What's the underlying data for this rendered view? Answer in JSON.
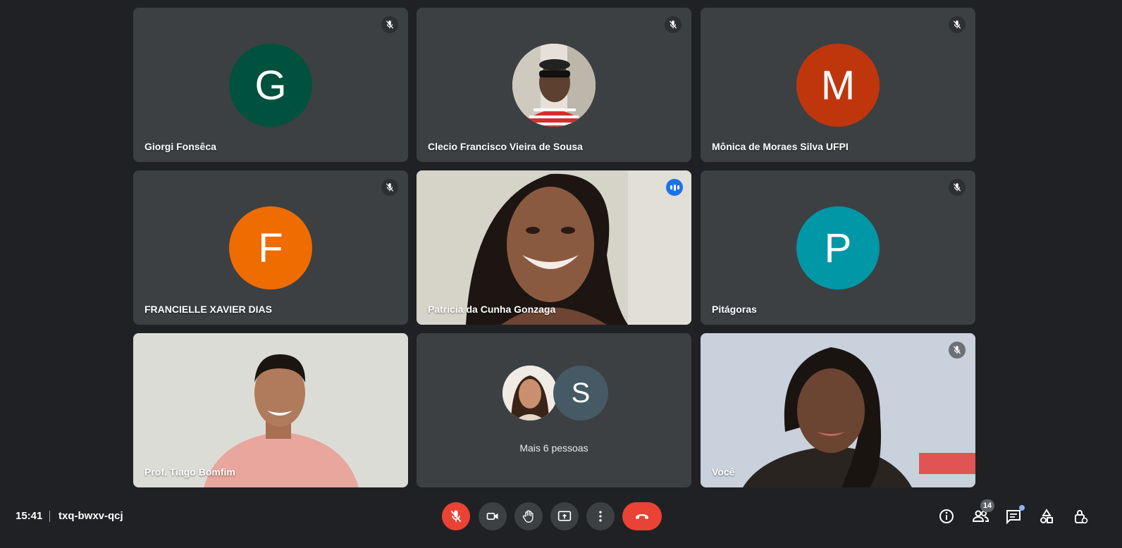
{
  "colors": {
    "background": "#202124",
    "tile": "#3c4043",
    "active_outline": "#8ab4f8",
    "danger": "#ea4335"
  },
  "participants": [
    {
      "name": "Giorgi Fonsêca",
      "initial": "G",
      "avatar_color": "#01513f",
      "muted": true
    },
    {
      "name": "Clecio Francisco Vieira de Sousa",
      "avatar": "photo",
      "muted": true
    },
    {
      "name": "Mônica de Moraes Silva UFPI",
      "initial": "M",
      "avatar_color": "#bf360c",
      "muted": true
    },
    {
      "name": "FRANCIELLE XAVIER DIAS",
      "initial": "F",
      "avatar_color": "#ef6c00",
      "muted": true
    },
    {
      "name": "Patricia da Cunha Gonzaga",
      "video": true,
      "speaking": true
    },
    {
      "name": "Pitágoras",
      "initial": "P",
      "avatar_color": "#0097a7",
      "muted": true
    },
    {
      "name": "Prof. Tiago Bomfim",
      "video": true,
      "muted": false
    },
    {
      "more_label": "Mais 6 pessoas",
      "more_initial": "S",
      "more_color": "#455a64"
    },
    {
      "name": "Você",
      "video": true,
      "muted": true
    }
  ],
  "bottombar": {
    "time": "15:41",
    "meeting_code": "txq-bwxv-qcj",
    "controls": [
      "mic-off-icon",
      "camera-icon",
      "raise-hand-icon",
      "present-icon",
      "more-options-icon",
      "hangup-icon"
    ],
    "people_count": "14"
  }
}
